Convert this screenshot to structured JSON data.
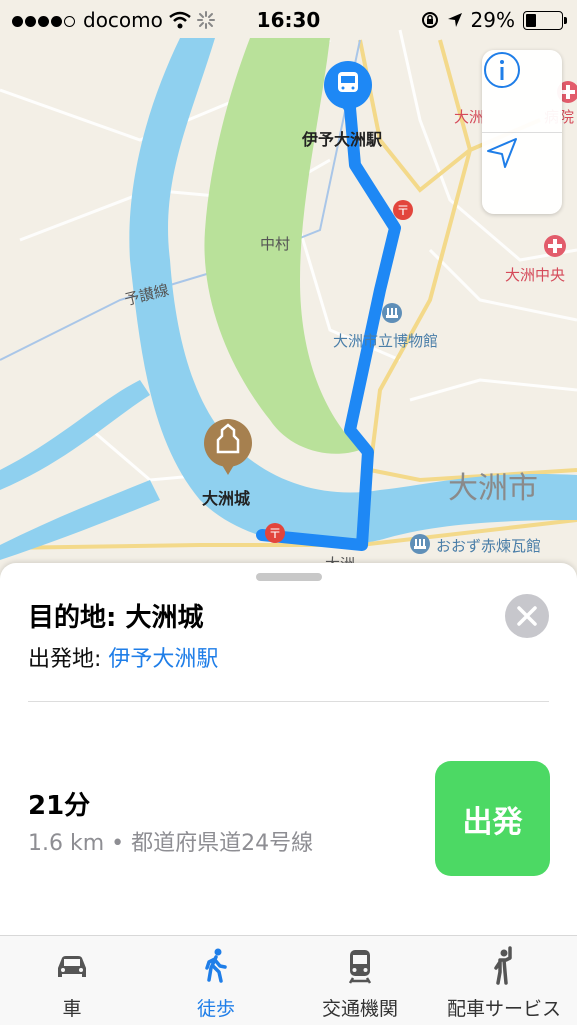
{
  "status_bar": {
    "carrier": "docomo",
    "time": "16:30",
    "battery": "29%"
  },
  "map": {
    "labels": {
      "station": "伊予大洲駅",
      "nakamura": "中村",
      "yosan_line": "予讃線",
      "museum": "大洲市立博物館",
      "castle": "大洲城",
      "city": "大洲市",
      "hospital_top": "大洲",
      "hospital_top2": "病院",
      "hospital_mid": "大洲中央",
      "brick_hall": "おおず赤煉瓦館",
      "ozu_partial": "大洲"
    },
    "route_color": "#1e88f5",
    "river_color": "#8fd0ef",
    "park_color": "#b9e19a"
  },
  "controls": {
    "info_icon": "info-icon",
    "location_icon": "location-arrow-icon"
  },
  "sheet": {
    "destination": "目的地: 大洲城",
    "origin_prefix": "出発地: ",
    "origin_link": "伊予大洲駅",
    "duration": "21分",
    "distance": "1.6 km • 都道府県道24号線",
    "go_button": "出発"
  },
  "tabs": [
    {
      "label": "車",
      "icon": "car-icon",
      "active": false
    },
    {
      "label": "徒歩",
      "icon": "walk-icon",
      "active": true
    },
    {
      "label": "交通機関",
      "icon": "train-icon",
      "active": false
    },
    {
      "label": "配車サービス",
      "icon": "ride-hail-icon",
      "active": false
    }
  ]
}
